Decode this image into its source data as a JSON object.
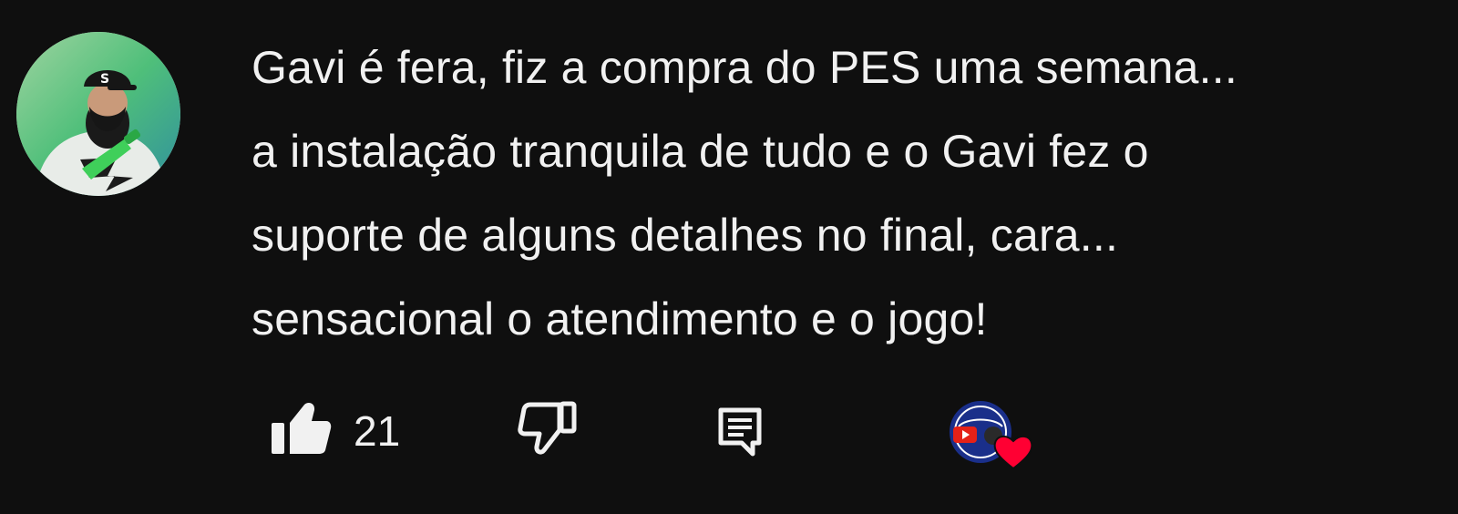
{
  "comment": {
    "text_lines": [
      "Gavi é fera, fiz a compra do PES uma semana...",
      "a instalação tranquila de tudo e o Gavi fez o",
      "suporte de alguns detalhes no final, cara...",
      "sensacional o atendimento e o jogo!"
    ],
    "text": "Gavi é fera, fiz a compra do PES uma semana...\na instalação tranquila de tudo e o Gavi fez o\nsuporte de alguns detalhes no final, cara...\nsensacional o atendimento e o jogo!"
  },
  "actions": {
    "like_count": "21",
    "like_icon": "thumbs-up-icon",
    "dislike_icon": "thumbs-down-icon",
    "reply_icon": "reply-comment-icon",
    "creator_heart_icon": "heart-icon"
  },
  "colors": {
    "background": "#0f0f0f",
    "text": "#f1f1f1",
    "heart": "#ff0033",
    "avatar_accent": "#37c35a"
  }
}
